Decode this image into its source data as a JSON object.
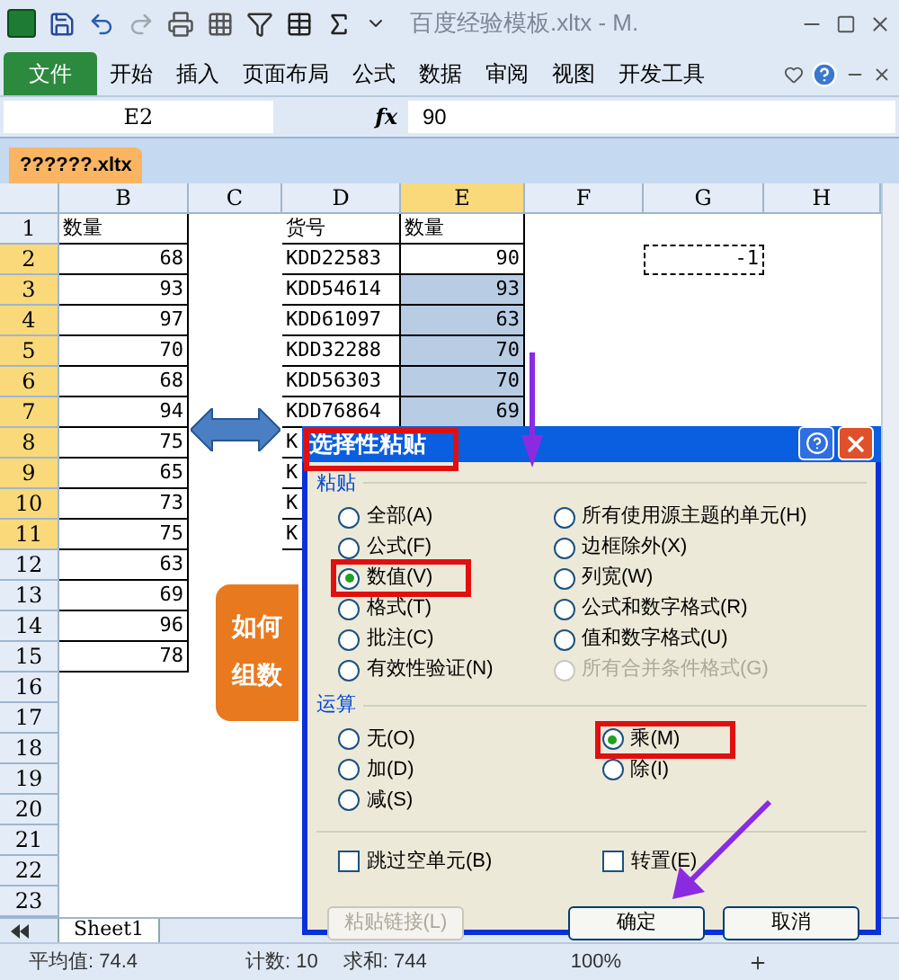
{
  "window": {
    "title": "百度经验模板.xltx - M."
  },
  "ribbon": {
    "file_tab": "文件",
    "tabs": [
      "开始",
      "插入",
      "页面布局",
      "公式",
      "数据",
      "审阅",
      "视图",
      "开发工具"
    ]
  },
  "formula_bar": {
    "cell_ref": "E2",
    "fx": "fx",
    "value": "90"
  },
  "workbook_tab": "??????.xltx",
  "columns": [
    {
      "label": "B",
      "selected": false
    },
    {
      "label": "C",
      "selected": false
    },
    {
      "label": "D",
      "selected": false
    },
    {
      "label": "E",
      "selected": true
    },
    {
      "label": "F",
      "selected": false
    },
    {
      "label": "G",
      "selected": false
    },
    {
      "label": "H",
      "selected": false
    }
  ],
  "rows": [
    {
      "number": "1",
      "selected": false,
      "b": "数量",
      "d": "货号",
      "e": "数量"
    },
    {
      "number": "2",
      "selected": true,
      "b": "68",
      "d": "KDD22583",
      "e": "90",
      "e_shaded": false,
      "g": "-1"
    },
    {
      "number": "3",
      "selected": true,
      "b": "93",
      "d": "KDD54614",
      "e": "93",
      "e_shaded": true
    },
    {
      "number": "4",
      "selected": true,
      "b": "97",
      "d": "KDD61097",
      "e": "63",
      "e_shaded": true
    },
    {
      "number": "5",
      "selected": true,
      "b": "70",
      "d": "KDD32288",
      "e": "70",
      "e_shaded": true
    },
    {
      "number": "6",
      "selected": true,
      "b": "68",
      "d": "KDD56303",
      "e": "70",
      "e_shaded": true
    },
    {
      "number": "7",
      "selected": true,
      "b": "94",
      "d": "KDD76864",
      "e": "69",
      "e_shaded": true
    },
    {
      "number": "8",
      "selected": true,
      "b": "75",
      "d": "K"
    },
    {
      "number": "9",
      "selected": true,
      "b": "65",
      "d": "K"
    },
    {
      "number": "10",
      "selected": true,
      "b": "73",
      "d": "K"
    },
    {
      "number": "11",
      "selected": true,
      "b": "75",
      "d": "K"
    },
    {
      "number": "12",
      "selected": false,
      "b": "63"
    },
    {
      "number": "13",
      "selected": false,
      "b": "69"
    },
    {
      "number": "14",
      "selected": false,
      "b": "96"
    },
    {
      "number": "15",
      "selected": false,
      "b": "78"
    },
    {
      "number": "16",
      "selected": false
    },
    {
      "number": "17",
      "selected": false
    },
    {
      "number": "18",
      "selected": false
    },
    {
      "number": "19",
      "selected": false
    },
    {
      "number": "20",
      "selected": false
    },
    {
      "number": "21",
      "selected": false
    },
    {
      "number": "22",
      "selected": false
    },
    {
      "number": "23",
      "selected": false
    }
  ],
  "title_card": {
    "lines": [
      "如何",
      "组数"
    ]
  },
  "sheet_tab": "Sheet1",
  "dialog": {
    "title": "选择性粘贴",
    "title_highlighted": true,
    "paste": {
      "label": "粘贴",
      "options": [
        {
          "label": "全部(A)",
          "selected": false,
          "disabled": false,
          "highlighted": false
        },
        {
          "label": "公式(F)",
          "selected": false,
          "disabled": false,
          "highlighted": false
        },
        {
          "label": "数值(V)",
          "selected": true,
          "disabled": false,
          "highlighted": true
        },
        {
          "label": "格式(T)",
          "selected": false,
          "disabled": false,
          "highlighted": false
        },
        {
          "label": "批注(C)",
          "selected": false,
          "disabled": false,
          "highlighted": false
        },
        {
          "label": "有效性验证(N)",
          "selected": false,
          "disabled": false,
          "highlighted": false
        },
        {
          "label": "所有使用源主题的单元(H)",
          "selected": false,
          "disabled": false,
          "highlighted": false
        },
        {
          "label": "边框除外(X)",
          "selected": false,
          "disabled": false,
          "highlighted": false
        },
        {
          "label": "列宽(W)",
          "selected": false,
          "disabled": false,
          "highlighted": false
        },
        {
          "label": "公式和数字格式(R)",
          "selected": false,
          "disabled": false,
          "highlighted": false
        },
        {
          "label": "值和数字格式(U)",
          "selected": false,
          "disabled": false,
          "highlighted": false
        },
        {
          "label": "所有合并条件格式(G)",
          "selected": false,
          "disabled": true,
          "highlighted": false
        }
      ]
    },
    "operation": {
      "label": "运算",
      "options": [
        {
          "label": "无(O)",
          "selected": false,
          "highlighted": false
        },
        {
          "label": "加(D)",
          "selected": false,
          "highlighted": false
        },
        {
          "label": "减(S)",
          "selected": false,
          "highlighted": false
        },
        {
          "label": "乘(M)",
          "selected": true,
          "highlighted": true
        },
        {
          "label": "除(I)",
          "selected": false,
          "highlighted": false
        }
      ]
    },
    "checkboxes": [
      {
        "label": "跳过空单元(B)",
        "checked": false
      },
      {
        "label": "转置(E)",
        "checked": false
      }
    ],
    "buttons": [
      {
        "label": "粘贴链接(L)",
        "disabled": true
      },
      {
        "label": "确定",
        "disabled": false
      },
      {
        "label": "取消",
        "disabled": false
      }
    ]
  },
  "status_bar": {
    "average": "平均值: 74.4",
    "count": "计数: 10",
    "sum": "求和: 744",
    "zoom": "100%"
  }
}
